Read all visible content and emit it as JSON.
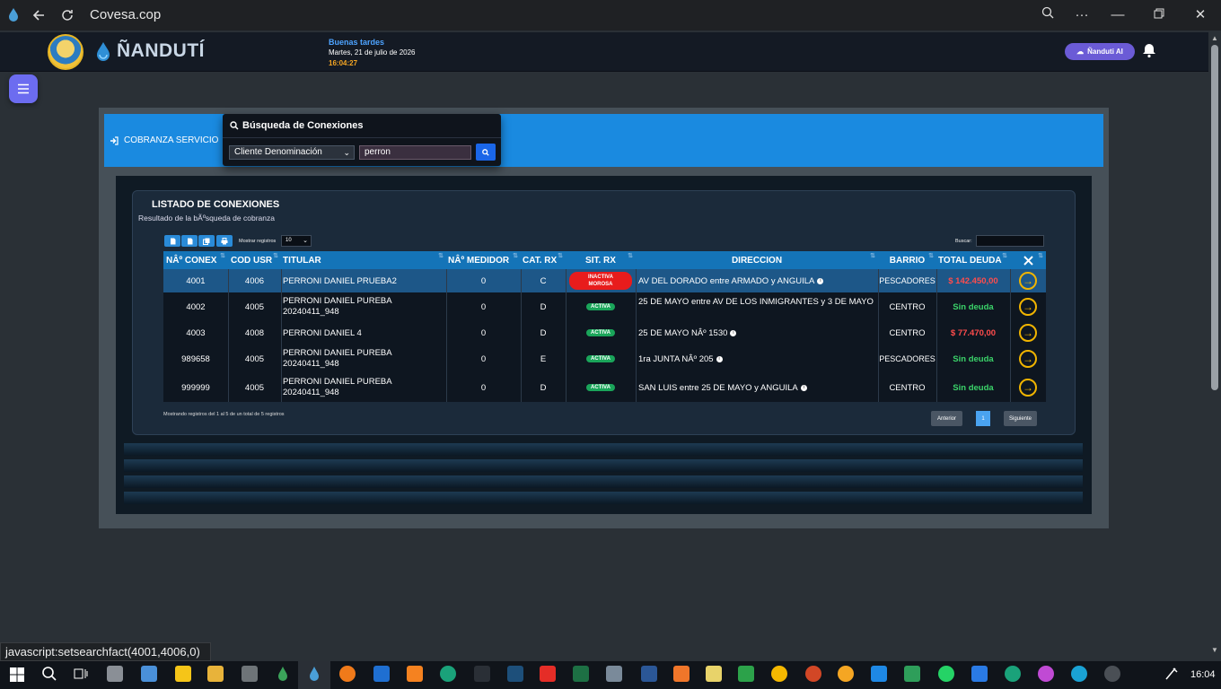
{
  "browser": {
    "title": "Covesa.cop"
  },
  "header": {
    "brand": "ÑANDUTÍ",
    "logo_text": "CO.VE.SA",
    "greeting": "Buenas tardes",
    "date": "Martes, 21 de julio de 2026",
    "time": "16:04:27",
    "ai_button": "Ñanduti AI"
  },
  "section": {
    "title": "COBRANZA SERVICIO"
  },
  "search_panel": {
    "title": "Búsqueda de Conexiones",
    "select_value": "Cliente Denominación",
    "input_value": "perron"
  },
  "listing": {
    "title": "LISTADO DE CONEXIONES",
    "subtitle": "Resultado de la bÃºsqueda de cobranza",
    "show_label": "Mostrar registros",
    "page_length": "10",
    "search_label": "Buscar:",
    "footer_info": "Mostrando registros del 1 al 5 de un total de 5 registros",
    "prev_label": "Anterior",
    "page_number": "1",
    "next_label": "Siguiente",
    "columns": [
      "NÂº CONEX",
      "COD USR",
      "TITULAR",
      "NÂº MEDIDOR",
      "CAT. RX",
      "SIT. RX",
      "DIRECCION",
      "BARRIO",
      "TOTAL DEUDA"
    ],
    "rows": [
      {
        "conex": "4001",
        "cod_usr": "4006",
        "titular": "PERRONI DANIEL PRUEBA2",
        "titular2": "",
        "medidor": "0",
        "cat": "C",
        "sit": "INACTIVA MOROSA",
        "sit_type": "inactiva",
        "direccion": "AV DEL DORADO entre ARMADO y ANGUILA",
        "barrio": "PESCADORES",
        "deuda": "$ 142.450,00",
        "deuda_type": "debt"
      },
      {
        "conex": "4002",
        "cod_usr": "4005",
        "titular": "PERRONI DANIEL PUREBA",
        "titular2": "20240411_948",
        "medidor": "0",
        "cat": "D",
        "sit": "ACTIVA",
        "sit_type": "activa",
        "direccion": "25 DE MAYO entre AV DE LOS INMIGRANTES y 3 DE MAYO",
        "barrio": "CENTRO",
        "deuda": "Sin deuda",
        "deuda_type": "ok"
      },
      {
        "conex": "4003",
        "cod_usr": "4008",
        "titular": "PERRONI DANIEL 4",
        "titular2": "",
        "medidor": "0",
        "cat": "D",
        "sit": "ACTIVA",
        "sit_type": "activa",
        "direccion": "25 DE MAYO NÂº 1530",
        "barrio": "CENTRO",
        "deuda": "$ 77.470,00",
        "deuda_type": "debt"
      },
      {
        "conex": "989658",
        "cod_usr": "4005",
        "titular": "PERRONI DANIEL PUREBA",
        "titular2": "20240411_948",
        "medidor": "0",
        "cat": "E",
        "sit": "ACTIVA",
        "sit_type": "activa",
        "direccion": "1ra JUNTA NÂº 205",
        "barrio": "PESCADORES",
        "deuda": "Sin deuda",
        "deuda_type": "ok"
      },
      {
        "conex": "999999",
        "cod_usr": "4005",
        "titular": "PERRONI DANIEL PUREBA",
        "titular2": "20240411_948",
        "medidor": "0",
        "cat": "D",
        "sit": "ACTIVA",
        "sit_type": "activa",
        "direccion": "SAN LUIS entre 25 DE MAYO y ANGUILA",
        "barrio": "CENTRO",
        "deuda": "Sin deuda",
        "deuda_type": "ok"
      }
    ]
  },
  "status_bar": {
    "text": "javascript:setsearchfact(4001,4006,0)"
  },
  "taskbar": {
    "clock": "16:04"
  },
  "colors": {
    "accent_blue": "#1a8ae0",
    "debt_red": "#ff4c4c",
    "ok_green": "#3bd46a",
    "action_yellow": "#f0b400"
  }
}
